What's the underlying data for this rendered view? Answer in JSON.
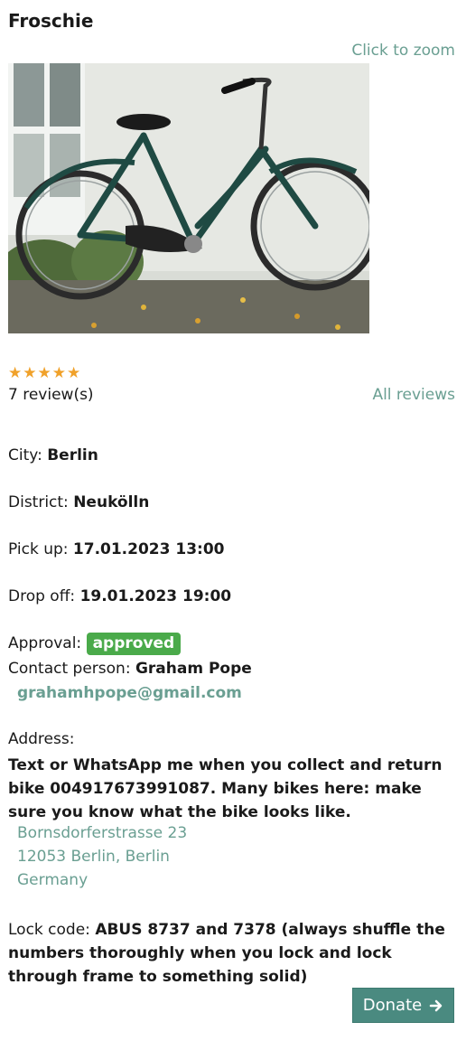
{
  "bike": {
    "title": "Froschie",
    "zoom_label": "Click to zoom"
  },
  "reviews": {
    "rating": 5,
    "max_rating": 5,
    "count_label": "7 review(s)",
    "all_label": "All reviews"
  },
  "details": {
    "city_label": "City:",
    "city": "Berlin",
    "district_label": "District:",
    "district": "Neukölln",
    "pickup_label": "Pick up:",
    "pickup": "17.01.2023 13:00",
    "dropoff_label": "Drop off:",
    "dropoff": "19.01.2023 19:00",
    "approval_label": "Approval:",
    "approval": "approved",
    "contact_label": "Contact person:",
    "contact": "Graham Pope",
    "email": "grahamhpope@gmail.com"
  },
  "address": {
    "label": "Address:",
    "note": "Text or WhatsApp me when you collect and return bike 004917673991087. Many bikes here: make sure you know what the bike looks like.",
    "street": "Bornsdorferstrasse 23",
    "city_line": "12053 Berlin, Berlin",
    "country": "Germany"
  },
  "lock": {
    "label": "Lock code:",
    "code": "ABUS 8737 and 7378 (always shuffle the numbers thoroughly when you lock and lock through frame to something solid)"
  },
  "actions": {
    "donate_label": "Donate"
  },
  "colors": {
    "link": "#6a9f92",
    "star": "#f0a12a",
    "approved_badge": "#4aaa4a",
    "donate_button": "#4a8a80"
  },
  "icons": {
    "rating": "star-icon",
    "donate": "arrow-right-icon"
  }
}
